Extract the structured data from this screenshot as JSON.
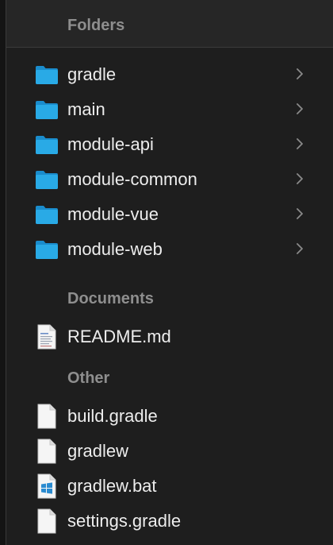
{
  "sections": {
    "folders": {
      "title": "Folders",
      "items": [
        {
          "label": "gradle",
          "icon": "folder-icon"
        },
        {
          "label": "main",
          "icon": "folder-icon"
        },
        {
          "label": "module-api",
          "icon": "folder-icon"
        },
        {
          "label": "module-common",
          "icon": "folder-icon"
        },
        {
          "label": "module-vue",
          "icon": "folder-icon"
        },
        {
          "label": "module-web",
          "icon": "folder-icon"
        }
      ]
    },
    "documents": {
      "title": "Documents",
      "items": [
        {
          "label": "README.md",
          "icon": "markdown-document-icon"
        }
      ]
    },
    "other": {
      "title": "Other",
      "items": [
        {
          "label": "build.gradle",
          "icon": "blank-document-icon"
        },
        {
          "label": "gradlew",
          "icon": "blank-document-icon"
        },
        {
          "label": "gradlew.bat",
          "icon": "windows-document-icon"
        },
        {
          "label": "settings.gradle",
          "icon": "blank-document-icon"
        }
      ]
    }
  },
  "colors": {
    "background": "#1e1e1e",
    "header_text": "#8e8e8e",
    "item_text": "#ededed",
    "folder_blue": "#1e9bd7",
    "chevron": "#8a8a8a"
  }
}
